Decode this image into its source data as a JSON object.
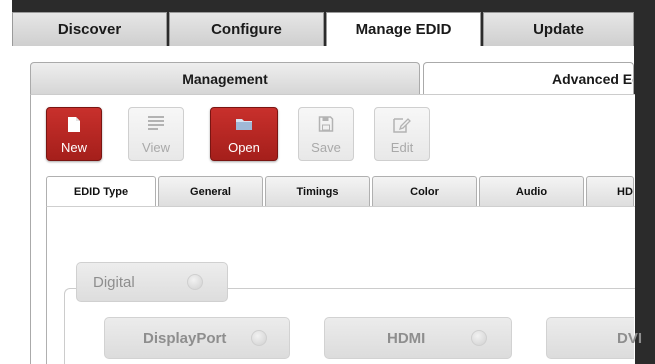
{
  "main_tabs": [
    {
      "label": "Discover",
      "active": false
    },
    {
      "label": "Configure",
      "active": false
    },
    {
      "label": "Manage EDID",
      "active": true
    },
    {
      "label": "Update",
      "active": false
    }
  ],
  "mode_tabs": [
    {
      "label": "Management",
      "active": false
    },
    {
      "label": "Advanced Ed",
      "active": true
    }
  ],
  "toolbar": {
    "new_label": "New",
    "view_label": "View",
    "open_label": "Open",
    "save_label": "Save",
    "edit_label": "Edit"
  },
  "edid_tabs": [
    {
      "label": "EDID Type",
      "active": true
    },
    {
      "label": "General",
      "active": false
    },
    {
      "label": "Timings",
      "active": false
    },
    {
      "label": "Color",
      "active": false
    },
    {
      "label": "Audio",
      "active": false
    },
    {
      "label": "HDM",
      "active": false
    }
  ],
  "edid_type": {
    "group_label": "Digital",
    "options": [
      "DisplayPort",
      "HDMI",
      "DVI"
    ]
  },
  "colors": {
    "accent_red": "#b52824",
    "disabled_text": "#8e8e8e"
  }
}
